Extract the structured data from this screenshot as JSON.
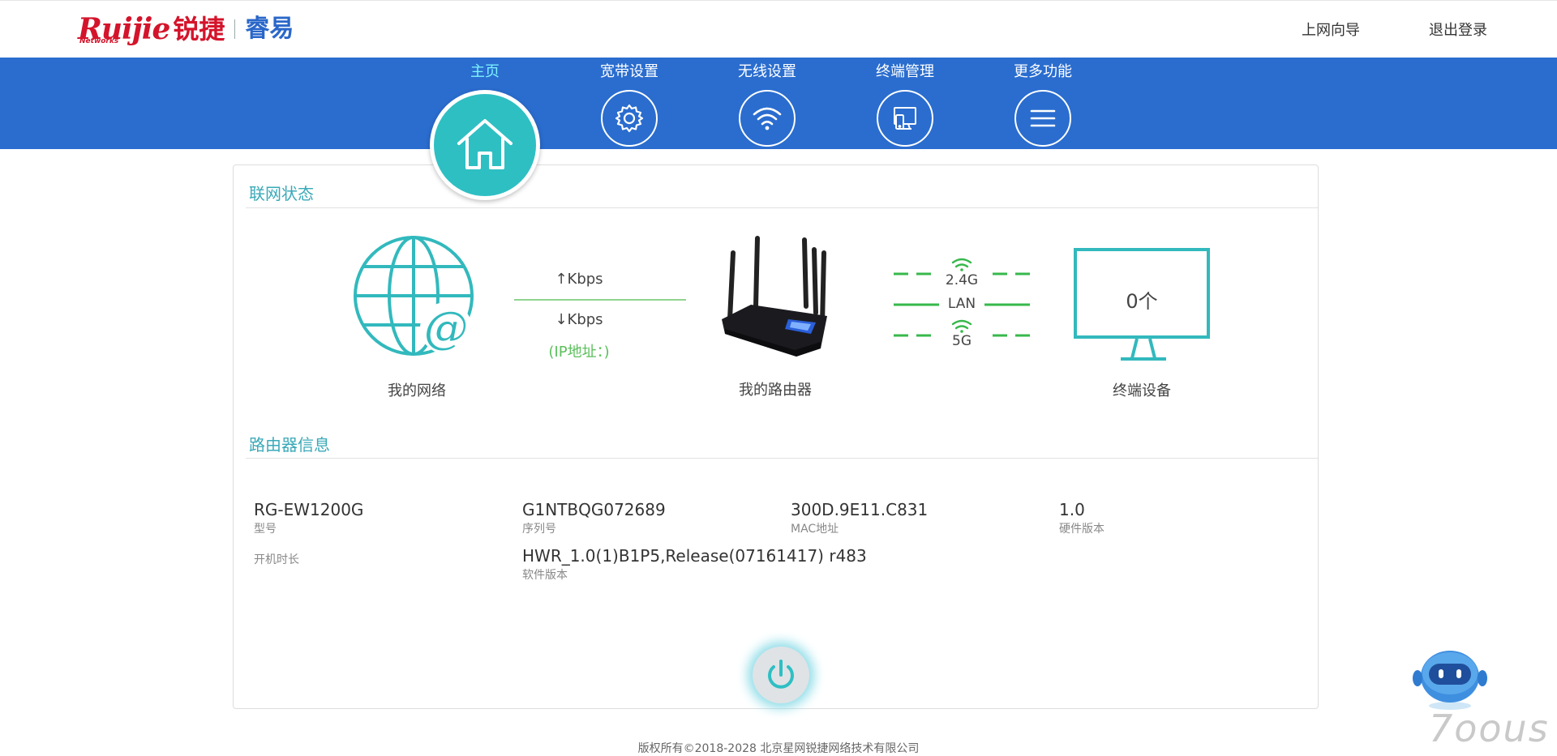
{
  "header": {
    "logo_brand": "Ruijie",
    "logo_networks": "Networks",
    "logo_cn": "锐捷",
    "logo_product": "睿易",
    "links": [
      {
        "label": "上网向导"
      },
      {
        "label": "退出登录"
      }
    ]
  },
  "nav": {
    "items": [
      {
        "label": "主页",
        "icon": "home-icon",
        "active": true
      },
      {
        "label": "宽带设置",
        "icon": "gear-icon"
      },
      {
        "label": "无线设置",
        "icon": "wifi-icon"
      },
      {
        "label": "终端管理",
        "icon": "devices-icon"
      },
      {
        "label": "更多功能",
        "icon": "menu-icon"
      }
    ],
    "colors": {
      "bar": "#2a6dcf",
      "active_label": "#7ef3ff",
      "home_circle": "#2ebfc3"
    }
  },
  "network_status": {
    "title": "联网状态",
    "my_network": "我的网络",
    "upload": "↑Kbps",
    "download": "↓Kbps",
    "ip": "(IP地址：)",
    "my_router": "我的路由器",
    "band_24g": "2.4G",
    "band_lan": "LAN",
    "band_5g": "5G",
    "terminal_count": "0个",
    "terminal_label": "终端设备"
  },
  "router_info": {
    "title": "路由器信息",
    "fields": [
      {
        "value": "RG-EW1200G",
        "label": "型号"
      },
      {
        "value": "G1NTBQG072689",
        "label": "序列号"
      },
      {
        "value": "300D.9E11.C831",
        "label": "MAC地址"
      },
      {
        "value": "1.0",
        "label": "硬件版本"
      },
      {
        "value": "",
        "label": "开机时长"
      },
      {
        "value": "HWR_1.0(1)B1P5,Release(07161417) r483",
        "label": "软件版本"
      }
    ]
  },
  "footer": {
    "copyright": "版权所有©2018-2028 北京星网锐捷网络技术有限公司"
  },
  "watermark": "7oous"
}
